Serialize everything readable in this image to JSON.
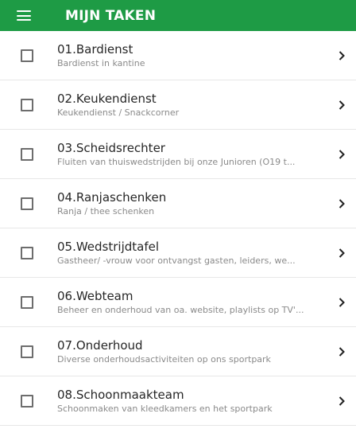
{
  "header": {
    "title": "MIJN TAKEN",
    "menu_icon": "hamburger-menu-icon"
  },
  "colors": {
    "brand": "#1e9b45",
    "title_text": "#ffffff",
    "item_text": "#262626",
    "item_subtext": "#8a8a8a",
    "divider": "#e7e7e7"
  },
  "tasks": [
    {
      "title": "01.Bardienst",
      "subtitle": "Bardienst in kantine",
      "checked": false,
      "icon": "chevron-right-icon"
    },
    {
      "title": "02.Keukendienst",
      "subtitle": "Keukendienst / Snackcorner",
      "checked": false,
      "icon": "chevron-right-icon"
    },
    {
      "title": "03.Scheidsrechter",
      "subtitle": "Fluiten van thuiswedstrijden bij onze Junioren (O19 t...",
      "checked": false,
      "icon": "chevron-right-icon"
    },
    {
      "title": "04.Ranjaschenken",
      "subtitle": "Ranja / thee schenken",
      "checked": false,
      "icon": "chevron-right-icon"
    },
    {
      "title": "05.Wedstrijdtafel",
      "subtitle": "Gastheer/ -vrouw voor ontvangst gasten, leiders, we...",
      "checked": false,
      "icon": "chevron-right-icon"
    },
    {
      "title": "06.Webteam",
      "subtitle": "Beheer en onderhoud van oa. website, playlists op TV'...",
      "checked": false,
      "icon": "chevron-right-icon"
    },
    {
      "title": "07.Onderhoud",
      "subtitle": "Diverse onderhoudsactiviteiten op ons sportpark",
      "checked": false,
      "icon": "chevron-right-icon"
    },
    {
      "title": "08.Schoonmaakteam",
      "subtitle": "Schoonmaken van kleedkamers en het sportpark",
      "checked": false,
      "icon": "chevron-right-icon"
    }
  ]
}
